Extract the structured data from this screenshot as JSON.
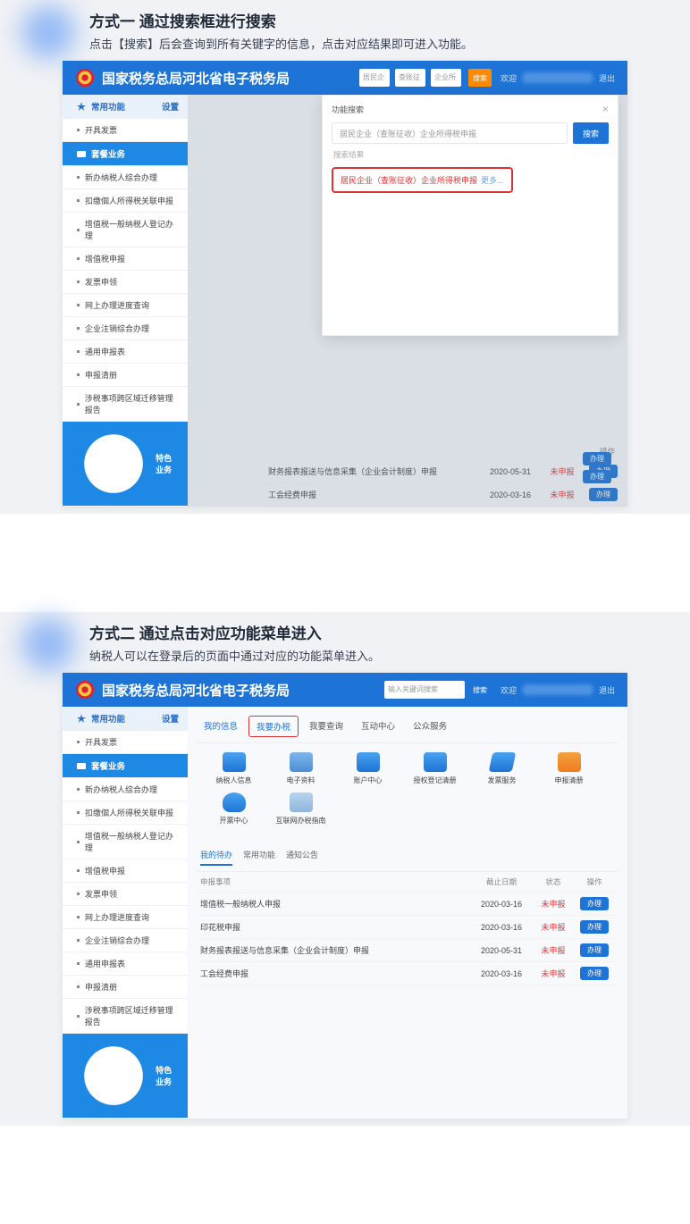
{
  "section1": {
    "title": "方式一 通过搜索框进行搜索",
    "desc": "点击【搜索】后会查询到所有关键字的信息，点击对应结果即可进入功能。"
  },
  "section2": {
    "title": "方式二 通过点击对应功能菜单进入",
    "desc": "纳税人可以在登录后的页面中通过对应的功能菜单进入。"
  },
  "site": {
    "name": "国家税务总局河北省电子税务局",
    "search_placeholder": "输入关键词搜索",
    "search_btn": "搜索",
    "welcome": "欢迎",
    "logout": "退出"
  },
  "top_segments": [
    "居民企业",
    "查账征收",
    "企业所得..."
  ],
  "sidebar": {
    "group1": "常用功能",
    "group2": "套餐业务",
    "footer": "特色业务",
    "link": "设置",
    "items": [
      "开具发票",
      "新办纳税人综合办理",
      "扣缴個人所得税关联申报",
      "增值税一般纳税人登记办理",
      "增值税申报",
      "发票申领",
      "网上办理进度查询",
      "企业注销综合办理",
      "通用申报表",
      "申报清册",
      "涉税事项跨区域迁移管理报告"
    ]
  },
  "modal": {
    "title": "功能搜索",
    "placeholder": "居民企业（查账征收）企业所得税申报",
    "hint": "搜索结果",
    "btn": "搜索",
    "result": "居民企业（查账征收）企业所得税申报",
    "more": "更多..."
  },
  "right_icon_label": "申报清册",
  "tabs": [
    "我的信息",
    "我要办税",
    "我要查询",
    "互动中心",
    "公众服务"
  ],
  "grid": [
    "纳税人信息",
    "电子资料",
    "账户中心",
    "授权登记清册",
    "发票服务",
    "申报清册",
    "开票中心",
    "互联网办税指南"
  ],
  "sub_tabs": [
    "我的待办",
    "常用功能",
    "通知公告"
  ],
  "table": {
    "head": {
      "name": "申报事项",
      "date": "截止日期",
      "status": "状态",
      "op": "操作"
    },
    "rows": [
      {
        "name": "增值税一般纳税人申报",
        "date": "2020-03-16",
        "status": "未申报",
        "op": "办理"
      },
      {
        "name": "印花税申报",
        "date": "2020-03-16",
        "status": "未申报",
        "op": "办理"
      },
      {
        "name": "财务报表报送与信息采集（企业会计制度）申报",
        "date": "2020-05-31",
        "status": "未申报",
        "op": "办理"
      },
      {
        "name": "工会经费申报",
        "date": "2020-03-16",
        "status": "未申报",
        "op": "办理"
      }
    ]
  },
  "extra_label": "操作",
  "extra_pill": "办理"
}
